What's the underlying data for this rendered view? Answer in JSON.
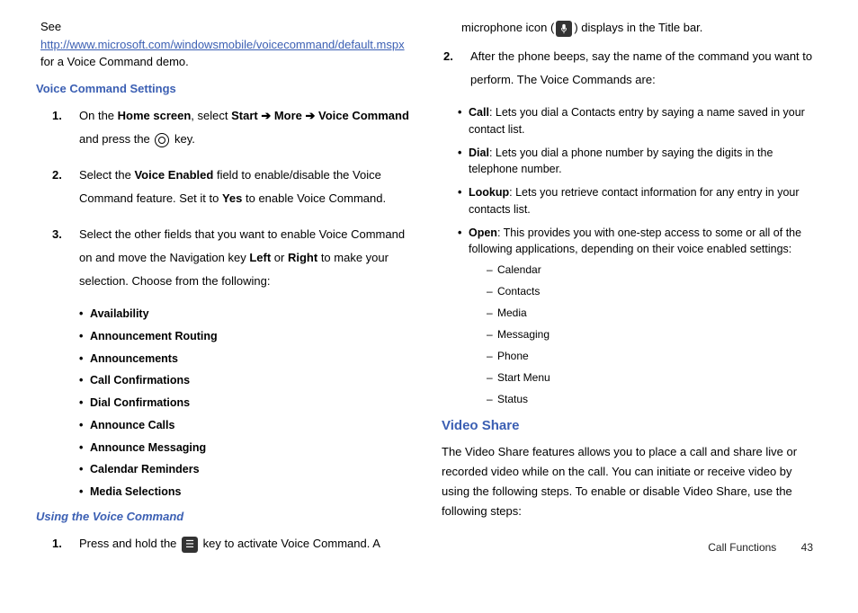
{
  "col1": {
    "intro_prefix": "See ",
    "intro_link": "http://www.microsoft.com/windowsmobile/voicecommand/default.mspx",
    "intro_suffix": " for a Voice Command demo.",
    "h_settings": "Voice Command Settings",
    "step1_num": "1.",
    "step1_a": "On the ",
    "step1_b": "Home screen",
    "step1_c": ", select ",
    "step1_d": "Start ➔ More ➔ Voice Command",
    "step1_e": " and press the ",
    "step1_f": " key.",
    "step2_num": "2.",
    "step2_a": "Select the ",
    "step2_b": "Voice Enabled",
    "step2_c": " field to enable/disable the Voice Command feature. Set it to ",
    "step2_d": "Yes",
    "step2_e": " to enable Voice Command.",
    "step3_num": "3.",
    "step3_a": "Select the other fields that you want to enable Voice Command on and move the Navigation key ",
    "step3_b": "Left",
    "step3_c": " or ",
    "step3_d": "Right",
    "step3_e": " to make your selection. Choose from the following:",
    "bullets": [
      "Availability",
      "Announcement Routing",
      "Announcements",
      "Call Confirmations",
      "Dial Confirmations",
      "Announce Calls",
      "Announce Messaging",
      "Calendar Reminders",
      "Media Selections"
    ],
    "h_using": "Using the Voice Command",
    "use1_num": "1.",
    "use1_a": "Press and hold the ",
    "use1_b": " key to activate Voice Command. A"
  },
  "col2": {
    "cont_a": "microphone icon (",
    "cont_b": ") displays in the Title bar.",
    "step2_num": "2.",
    "step2_text": "After the phone beeps, say the name of the command you want to perform. The Voice Commands are:",
    "cmds": {
      "call_b": "Call",
      "call_t": ": Lets you dial a Contacts entry by saying a name saved in your contact list.",
      "dial_b": "Dial",
      "dial_t": ": Lets you dial a phone number by saying the digits in the telephone number.",
      "lookup_b": "Lookup",
      "lookup_t": ": Lets you retrieve contact information for any entry in your contacts list.",
      "open_b": "Open",
      "open_t": ": This provides you with one-step access to some or all of the following applications, depending on their voice enabled settings:"
    },
    "apps": [
      "Calendar",
      "Contacts",
      "Media",
      "Messaging",
      "Phone",
      "Start Menu",
      "Status"
    ],
    "h_video": "Video Share",
    "video_p": "The Video Share features allows you to place a call and share live or recorded video while on the call. You can initiate or receive video by using the following steps. To enable or disable Video Share, use the following steps:"
  },
  "footer": {
    "section": "Call Functions",
    "page": "43"
  }
}
